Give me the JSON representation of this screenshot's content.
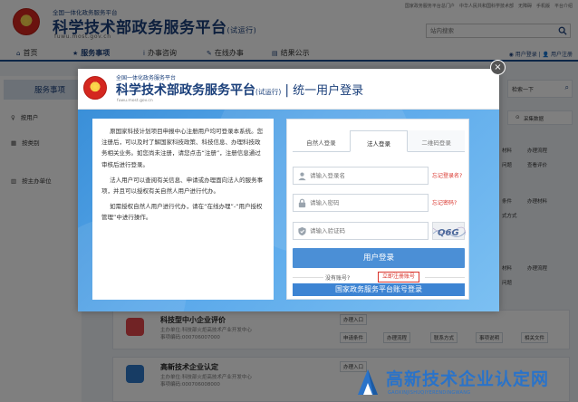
{
  "topbar": {
    "links": [
      "国家政务服务平台总门户",
      "中华人民共和国科学技术部",
      "无障碍",
      "手机版",
      "平台介绍"
    ]
  },
  "header": {
    "small_title": "全国一体化政务服务平台",
    "title": "科学技术部政务服务平台",
    "trial": "(试运行)",
    "domain": "fuwu.most.gov.cn",
    "search_placeholder": "站内搜索"
  },
  "nav": {
    "items": [
      {
        "icon": "home-icon",
        "label": "首页"
      },
      {
        "icon": "star-icon",
        "label": "服务事项"
      },
      {
        "icon": "info-icon",
        "label": "办事咨询"
      },
      {
        "icon": "pencil-icon",
        "label": "在线办事"
      },
      {
        "icon": "notice-icon",
        "label": "结果公示"
      }
    ],
    "user_login": "用户登录",
    "user_register": "用户注册"
  },
  "left_panel": {
    "heading": "服务事项",
    "items": [
      {
        "icon": "person-icon",
        "label": "按用户"
      },
      {
        "icon": "grid-icon",
        "label": "按类别"
      },
      {
        "icon": "building-icon",
        "label": "按主办单位"
      }
    ]
  },
  "right_panel": {
    "search_fragment": "检索一下",
    "collect_label": "采集数据",
    "row1": [
      "材料",
      "办理流程"
    ],
    "row2": [
      "问题",
      "查看评价"
    ],
    "row3": [
      "条件",
      "办理材料"
    ],
    "row4": [
      "式方式"
    ],
    "row5": [
      "材料",
      "办理流程"
    ],
    "row6": [
      "问题"
    ]
  },
  "services": [
    {
      "title": "科技型中小企业评价",
      "organizer": "主办单位:科技部火炬高技术产业开发中心",
      "code": "事项编码:000706007000",
      "entry": "办理入口",
      "actions": [
        "申请条件",
        "办理流程",
        "联系方式",
        "事项说明",
        "相关文件"
      ],
      "badge_color": "#e2474b"
    },
    {
      "title": "高新技术企业认定",
      "organizer": "主办单位:科技部火炬高技术产业开发中心",
      "code": "事项编码:000706008000",
      "entry": "办理入口",
      "badge_color": "#2f78c9"
    }
  ],
  "modal": {
    "small_title": "全国一体化政务服务平台",
    "title": "科学技术部政务服务平台",
    "trial": "(试运行)",
    "separator": "|",
    "unified": "统一用户登录",
    "domain": "fuwu.most.gov.cn",
    "close_label": "×",
    "info_paragraphs": [
      "原国家科技计划项目申报中心注册用户均可登录本系统。您注册后，可以及时了解国家科技政策、科技信息、办理科技政务相关业务。如您尚未注册，请您点击“注册”，注册信息通过审核后进行登录。",
      "法人用户可以查阅有关信息、申请或办理面向法人的服务事项，并且可以授权有关自然人用户进行代办。",
      "如需授权自然人用户进行代办，请在“在线办理”-“用户授权管理”中进行操作。"
    ],
    "tabs": [
      "自然人登录",
      "法人登录",
      "二维码登录"
    ],
    "active_tab": "法人登录",
    "username_placeholder": "请输入登录名",
    "password_placeholder": "请输入密码",
    "captcha_placeholder": "请输入验证码",
    "forgot_username": "忘记登录名?",
    "forgot_password": "忘记密码?",
    "captcha_text": "Q6G",
    "login_button": "用户登录",
    "no_account": "没有账号?",
    "register_link": "立即注册账号",
    "national_button": "国家政务服务平台账号登录"
  },
  "watermark": {
    "text": "高新技术企业认定网",
    "subtext": "GAOXINJISHUQIYERENDINGWANG"
  },
  "colors": {
    "primary": "#1a3f7a",
    "modal_blue": "#3a8fd8",
    "button_blue": "#4b8fd6",
    "alert_red": "#d9322a"
  }
}
